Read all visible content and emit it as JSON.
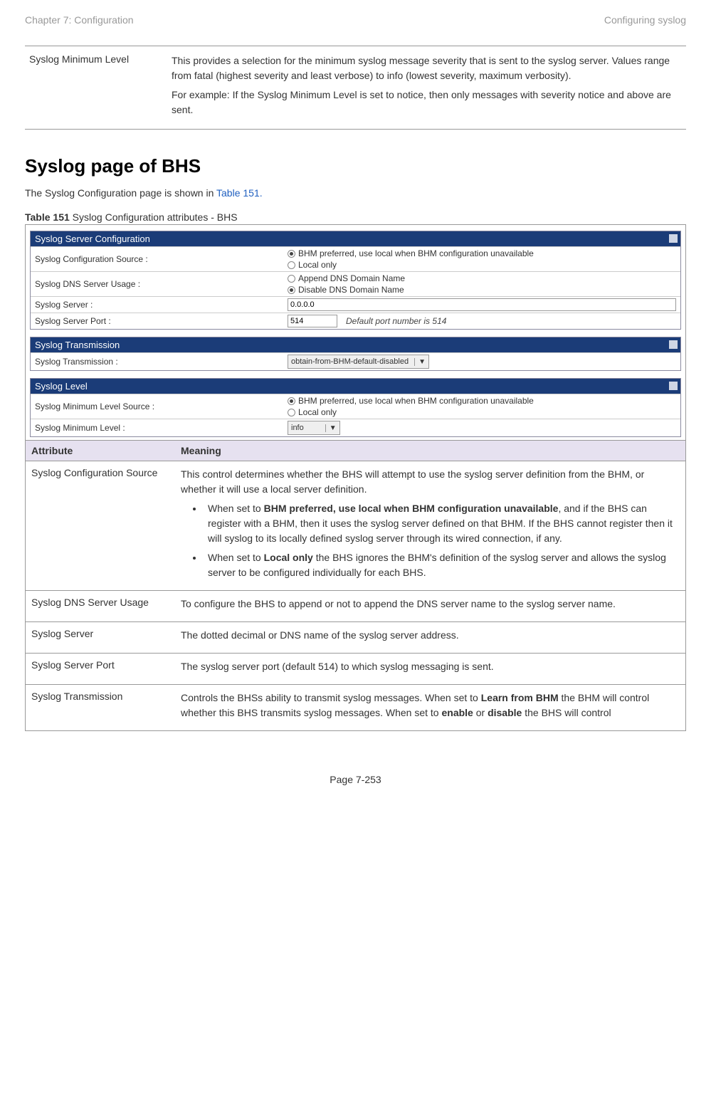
{
  "header": {
    "left": "Chapter 7:  Configuration",
    "right": "Configuring syslog"
  },
  "top_row": {
    "attr": "Syslog Minimum Level",
    "p1": "This provides a selection for the minimum syslog message severity that is sent to the syslog server. Values range from fatal (highest severity and least verbose) to info (lowest severity, maximum verbosity).",
    "p2": "For example: If the Syslog Minimum Level is set to notice, then only messages with severity notice and above are sent."
  },
  "section_heading": "Syslog page of BHS",
  "intro_pre": "The Syslog Configuration page is shown in ",
  "intro_link": "Table 151.",
  "caption_bold": "Table 151",
  "caption_rest": " Syslog Configuration attributes - BHS",
  "ui": {
    "panel1_title": "Syslog Server Configuration",
    "cfg_src_label": "Syslog Configuration Source :",
    "cfg_src_opt1": "BHM preferred, use local when BHM configuration unavailable",
    "cfg_src_opt2": "Local only",
    "dns_label": "Syslog DNS Server Usage :",
    "dns_opt1": "Append DNS Domain Name",
    "dns_opt2": "Disable DNS Domain Name",
    "server_label": "Syslog Server :",
    "server_value": "0.0.0.0",
    "port_label": "Syslog Server Port :",
    "port_value": "514",
    "port_note": "Default port number is 514",
    "panel2_title": "Syslog Transmission",
    "trans_label": "Syslog Transmission :",
    "trans_value": "obtain-from-BHM-default-disabled",
    "panel3_title": "Syslog Level",
    "minlvl_src_label": "Syslog Minimum Level Source :",
    "minlvl_src_opt1": "BHM preferred, use local when BHM configuration unavailable",
    "minlvl_src_opt2": "Local only",
    "minlvl_label": "Syslog Minimum Level :",
    "minlvl_value": "info"
  },
  "defs": {
    "header_attr": "Attribute",
    "header_meaning": "Meaning",
    "r1_attr": "Syslog Configuration Source",
    "r1_p1": "This control determines whether the BHS will attempt to use the syslog server definition from the BHM, or whether it will use a local server definition.",
    "r1_b1_pre": "When set to ",
    "r1_b1_bold": "BHM preferred, use local when BHM configuration unavailable",
    "r1_b1_post": ", and if the BHS can register with a BHM, then it uses the syslog server defined on that BHM. If the BHS cannot register then it will syslog to its locally defined syslog server through its wired connection, if any.",
    "r1_b2_pre": "When set to ",
    "r1_b2_bold": "Local only",
    "r1_b2_post": " the BHS ignores the BHM's definition of the syslog server and allows the syslog server to be configured individually for each BHS.",
    "r2_attr": "Syslog DNS Server Usage",
    "r2_meaning": "To configure the BHS to append or not to append the DNS server name to the syslog server name.",
    "r3_attr": "Syslog Server",
    "r3_meaning": "The dotted decimal or DNS name of the syslog server address.",
    "r4_attr": "Syslog Server Port",
    "r4_meaning": "The syslog server port (default 514) to which syslog messaging is sent.",
    "r5_attr": "Syslog Transmission",
    "r5_pre": "Controls the BHSs ability to transmit syslog messages. When set to ",
    "r5_bold1": "Learn from BHM",
    "r5_mid": " the BHM will control whether this BHS transmits syslog messages. When set to ",
    "r5_bold2": "enable",
    "r5_or": " or ",
    "r5_bold3": "disable",
    "r5_post": " the BHS will control"
  },
  "footer": "Page 7-253"
}
